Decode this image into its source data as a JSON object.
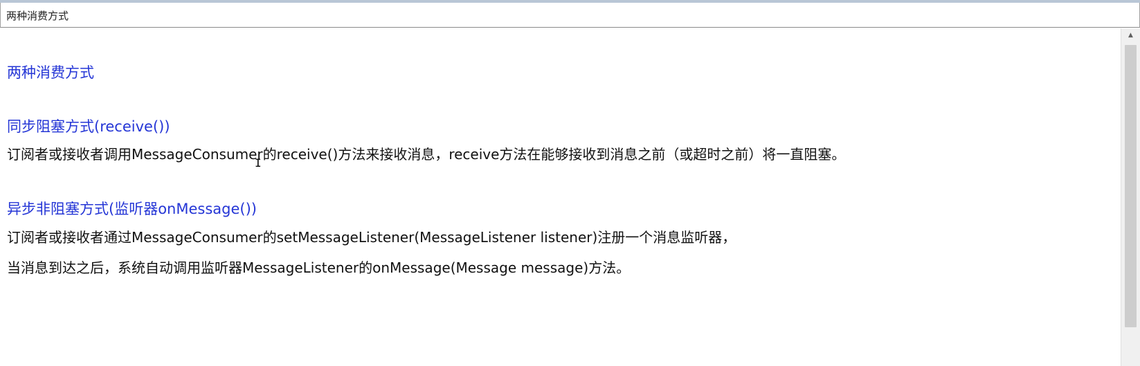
{
  "window": {
    "title": "两种消费方式"
  },
  "document": {
    "heading": "两种消费方式",
    "sync": {
      "heading": "同步阻塞方式(receive())",
      "text": "订阅者或接收者调用MessageConsumer的receive()方法来接收消息，receive方法在能够接收到消息之前（或超时之前）将一直阻塞。"
    },
    "async": {
      "heading": "异步非阻塞方式(监听器onMessage())",
      "text_line1": "订阅者或接收者通过MessageConsumer的setMessageListener(MessageListener listener)注册一个消息监听器，",
      "text_line2": "当消息到达之后，系统自动调用监听器MessageListener的onMessage(Message message)方法。"
    }
  },
  "colors": {
    "heading": "#2536d6",
    "body": "#111111"
  },
  "icons": {
    "scroll_up": "chevron-up-icon",
    "text_cursor": "i-beam-cursor-icon"
  }
}
